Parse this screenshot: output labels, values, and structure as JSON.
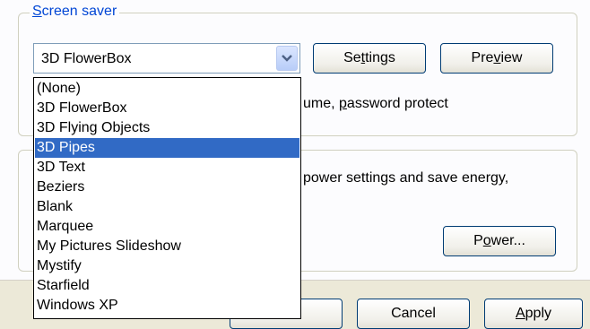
{
  "screensaver": {
    "group_label_accel": "S",
    "group_label_rest": "creen saver",
    "selected_value": "3D FlowerBox",
    "settings": {
      "pre": "Se",
      "accel": "t",
      "post": "tings"
    },
    "preview": {
      "pre": "Pre",
      "accel": "v",
      "post": "iew"
    },
    "options_text_pre": "ume, ",
    "options_text_accel": "p",
    "options_text_post": "assword protect",
    "dropdown_options": [
      "(None)",
      "3D FlowerBox",
      "3D Flying Objects",
      "3D Pipes",
      "3D Text",
      "Beziers",
      "Blank",
      "Marquee",
      "My Pictures Slideshow",
      "Mystify",
      "Starfield",
      "Windows XP"
    ],
    "highlighted_option": "3D Pipes"
  },
  "power": {
    "desc_line1": "power settings and save energy,",
    "button": {
      "pre": "P",
      "accel": "o",
      "post": "wer..."
    }
  },
  "dialog": {
    "cancel_label": "Cancel",
    "apply_accel": "A",
    "apply_rest": "pply"
  },
  "colors": {
    "highlight": "#316ac5",
    "group_label": "#0046d5",
    "button_border": "#003c74"
  }
}
